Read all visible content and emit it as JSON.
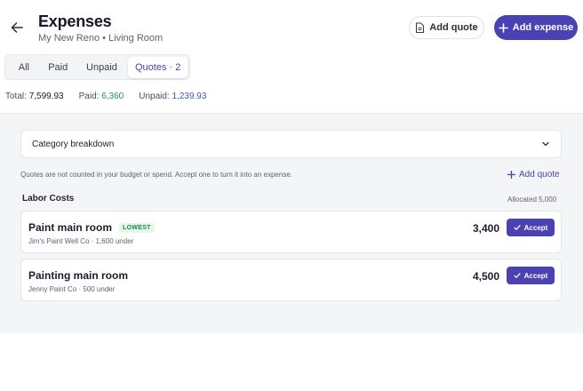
{
  "header": {
    "title": "Expenses",
    "subtitle": "My New Reno • Living Room",
    "add_quote_label": "Add quote",
    "add_expense_label": "Add expense"
  },
  "tabs": [
    {
      "label": "All",
      "active": false
    },
    {
      "label": "Paid",
      "active": false
    },
    {
      "label": "Unpaid",
      "active": false
    },
    {
      "label": "Quotes · 2",
      "active": true
    }
  ],
  "totals": {
    "total_label": "Total:",
    "total_value": "7,599.93",
    "paid_label": "Paid:",
    "paid_value": "6,360",
    "unpaid_label": "Unpaid:",
    "unpaid_value": "1,239.93"
  },
  "breakdown": {
    "label": "Category breakdown"
  },
  "note": "Quotes are not counted in your budget or spend. Accept one to turn it into an expense.",
  "add_quote_link": "Add quote",
  "section": {
    "title": "Labor Costs",
    "allocated": "Allocated 5,000"
  },
  "quotes": [
    {
      "name": "Paint main room",
      "badge": "LOWEST",
      "sub": "Jim's Paint Well Co · 1,600 under",
      "amount": "3,400",
      "accept_label": "Accept"
    },
    {
      "name": "Painting main room",
      "badge": "",
      "sub": "Jenny Paint Co · 500 under",
      "amount": "4,500",
      "accept_label": "Accept"
    }
  ],
  "colors": {
    "accent": "#4a41b3",
    "paid": "#1e9a4e",
    "unpaid": "#3d57c7",
    "badge_bg": "#e5f6eb",
    "badge_text": "#1e8a48"
  }
}
